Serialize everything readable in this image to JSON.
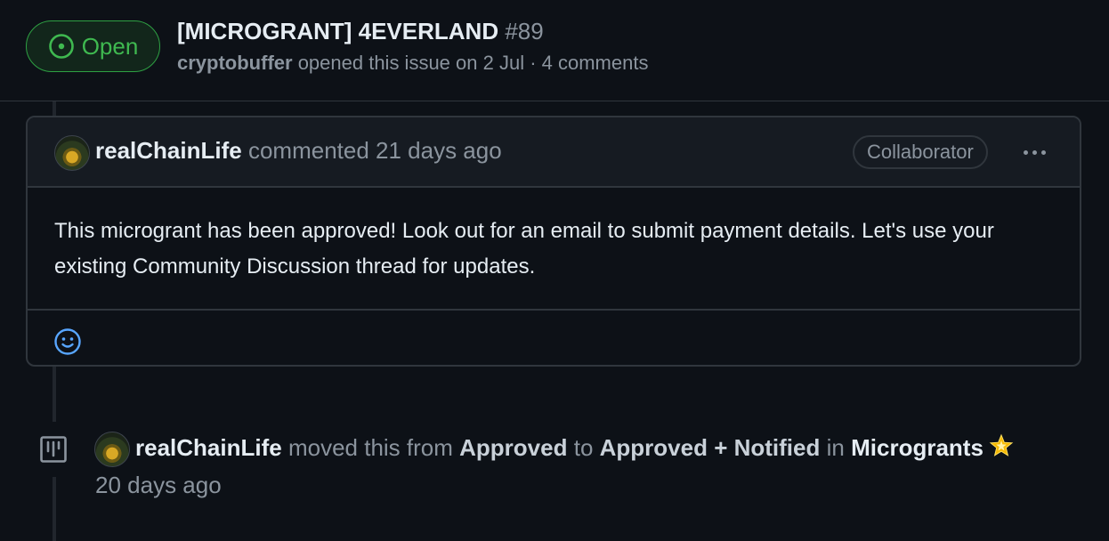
{
  "issue": {
    "state": "Open",
    "title": "[MICROGRANT] 4EVERLAND",
    "number": "#89",
    "author": "cryptobuffer",
    "opened_text": "opened this issue on 2 Jul · 4 comments"
  },
  "comment": {
    "author": "realChainLife",
    "action": "commented 21 days ago",
    "role": "Collaborator",
    "body": "This microgrant has been approved! Look out for an email to submit payment details. Let's use your existing Community Discussion thread for updates."
  },
  "event": {
    "actor": "realChainLife",
    "verb": "moved this from",
    "from_column": "Approved",
    "to_word": "to",
    "to_column": "Approved + Notified",
    "in_word": "in",
    "project": "Microgrants",
    "time": "20 days ago",
    "project_emoji": "star-emoji"
  },
  "icons": {
    "state": "issue-opened-icon",
    "menu": "kebab-icon",
    "reaction": "smiley-icon",
    "event": "project-icon"
  },
  "colors": {
    "background": "#0d1117",
    "open_green": "#3fb950",
    "border": "#30363d",
    "muted_text": "#8b949e",
    "reaction_blue": "#58a6ff"
  }
}
